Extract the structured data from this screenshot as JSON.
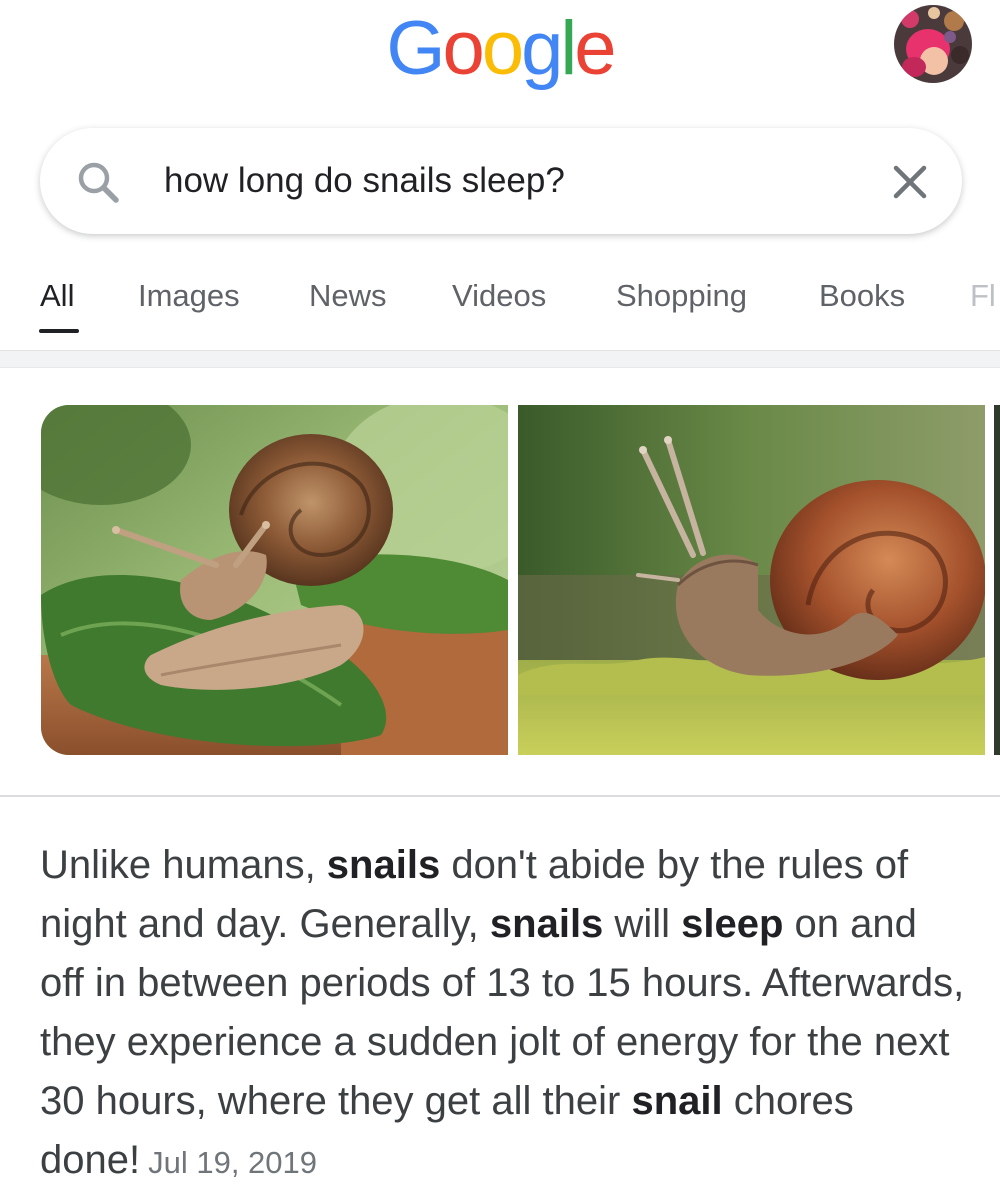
{
  "header": {
    "logo_letters": [
      {
        "char": "G",
        "color": "#4285F4"
      },
      {
        "char": "o",
        "color": "#EA4335"
      },
      {
        "char": "o",
        "color": "#FBBC05"
      },
      {
        "char": "g",
        "color": "#4285F4"
      },
      {
        "char": "l",
        "color": "#34A853"
      },
      {
        "char": "e",
        "color": "#EA4335"
      }
    ],
    "avatar_icon": "user-avatar"
  },
  "search": {
    "query": "how long do snails sleep?",
    "search_icon": "search-icon",
    "clear_icon": "close-icon"
  },
  "tabs": [
    {
      "label": "All",
      "active": true
    },
    {
      "label": "Images"
    },
    {
      "label": "News"
    },
    {
      "label": "Videos"
    },
    {
      "label": "Shopping"
    },
    {
      "label": "Books"
    },
    {
      "label": "Fl"
    }
  ],
  "images": [
    {
      "subject": "snail on green leaf"
    },
    {
      "subject": "snail on moss"
    }
  ],
  "snippet": {
    "p1": "Unlike humans, ",
    "b1": "snails",
    "p2": " don't abide by the rules of night and day. Generally, ",
    "b2": "snails",
    "p3": " will ",
    "b3": "sleep",
    "p4": " on and off in between periods of 13 to 15 hours. Afterwards, they experience a sudden jolt of energy for the next 30 hours, where they get all their ",
    "b4": "snail",
    "p5": " chores done!",
    "date": "Jul 19, 2019"
  },
  "colors": {
    "blue": "#4285F4",
    "red": "#EA4335",
    "yellow": "#FBBC05",
    "green": "#34A853",
    "text": "#3c4043",
    "muted": "#5f6368"
  }
}
